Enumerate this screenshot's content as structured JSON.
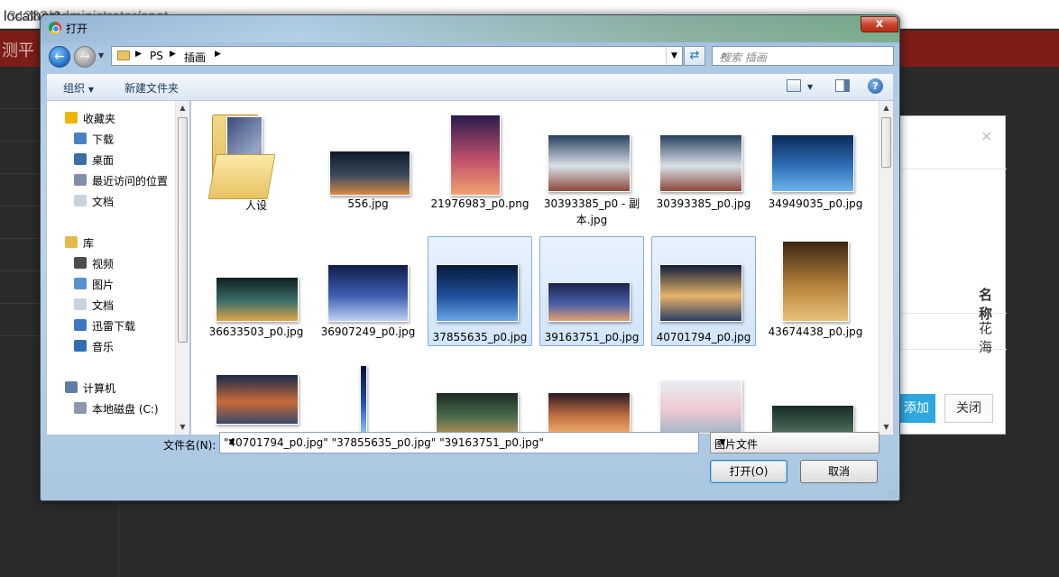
{
  "browser": {
    "url_visible": "localhost",
    "url_rest": ":34282/Administrator/spot",
    "header_title": "测平",
    "modal": {
      "close_glyph": "×",
      "column_header": "名称",
      "row_value": "花海",
      "add_button": "添加",
      "close_button": "关闭"
    }
  },
  "dialog": {
    "title": "打开",
    "close_glyph": "x",
    "breadcrumb": [
      "PS",
      "插画"
    ],
    "search_placeholder": "搜索 插画",
    "toolbar": {
      "organize": "组织",
      "new_folder": "新建文件夹"
    },
    "nav_items": [
      {
        "label": "收藏夹",
        "icon": "star-icon",
        "color": "#f0b400"
      },
      {
        "label": "下载",
        "icon": "download-folder-icon",
        "color": "#4a7fc1"
      },
      {
        "label": "桌面",
        "icon": "desktop-icon",
        "color": "#3a6ea5"
      },
      {
        "label": "最近访问的位置",
        "icon": "recent-places-icon",
        "color": "#7f8fa6"
      },
      {
        "label": "文档",
        "icon": "documents-icon",
        "color": "#c9d3df"
      },
      {
        "label": "库",
        "icon": "libraries-icon",
        "color": "#e5b94a"
      },
      {
        "label": "视频",
        "icon": "videos-icon",
        "color": "#4d4d4d"
      },
      {
        "label": "图片",
        "icon": "pictures-icon",
        "color": "#5a8fd0"
      },
      {
        "label": "文档",
        "icon": "documents-icon",
        "color": "#c9d3df"
      },
      {
        "label": "迅雷下载",
        "icon": "thunder-folder-icon",
        "color": "#3d77c4"
      },
      {
        "label": "音乐",
        "icon": "music-icon",
        "color": "#2f6db5"
      },
      {
        "label": "计算机",
        "icon": "computer-icon",
        "color": "#5c7ea8"
      },
      {
        "label": "本地磁盘 (C:)",
        "icon": "disk-icon",
        "color": "#8a99ab"
      }
    ],
    "files": [
      {
        "name": "人设",
        "type": "folder",
        "selected": false
      },
      {
        "name": "556.jpg",
        "type": "image",
        "selected": false,
        "colors": [
          "#0d1a2b",
          "#3a4a5c",
          "#d78a44"
        ]
      },
      {
        "name": "21976983_p0.png",
        "type": "image",
        "selected": false,
        "colors": [
          "#2a1b4d",
          "#c0506a",
          "#f0a070"
        ]
      },
      {
        "name": "30393385_p0 - 副本.jpg",
        "type": "image",
        "selected": false,
        "colors": [
          "#26405e",
          "#d9dfe6",
          "#8c4a3a"
        ]
      },
      {
        "name": "30393385_p0.jpg",
        "type": "image",
        "selected": false,
        "colors": [
          "#26405e",
          "#d9dfe6",
          "#8c4a3a"
        ]
      },
      {
        "name": "34949035_p0.jpg",
        "type": "image",
        "selected": false,
        "colors": [
          "#0a2a5a",
          "#2f6fb8",
          "#6bb3ea"
        ]
      },
      {
        "name": "36633503_p0.jpg",
        "type": "image",
        "selected": false,
        "colors": [
          "#0f1e22",
          "#3c6f6a",
          "#e0a64a"
        ]
      },
      {
        "name": "36907249_p0.jpg",
        "type": "image",
        "selected": false,
        "colors": [
          "#0e1d4a",
          "#3d5fb0",
          "#bcd2f0"
        ]
      },
      {
        "name": "37855635_p0.jpg",
        "type": "image",
        "selected": true,
        "colors": [
          "#061a3a",
          "#1f4f9a",
          "#6aa6e6"
        ]
      },
      {
        "name": "39163751_p0.jpg",
        "type": "image",
        "selected": true,
        "colors": [
          "#1b2450",
          "#4a5ea6",
          "#e0a070"
        ]
      },
      {
        "name": "40701794_p0.jpg",
        "type": "image",
        "selected": true,
        "colors": [
          "#101c38",
          "#e6b36a",
          "#2c3e66"
        ]
      },
      {
        "name": "43674438_p0.jpg",
        "type": "image",
        "selected": false,
        "colors": [
          "#3a2612",
          "#b5813a",
          "#e8c27a"
        ]
      },
      {
        "name": "",
        "type": "image",
        "selected": false,
        "colors": [
          "#1a2a4a",
          "#c86a3a",
          "#3a4a6a"
        ]
      },
      {
        "name": "",
        "type": "image",
        "selected": false,
        "colors": [
          "#061030",
          "#2050b0",
          "#8ac0ff"
        ]
      },
      {
        "name": "",
        "type": "image",
        "selected": false,
        "colors": [
          "#1a2a22",
          "#4a6a4a",
          "#b0905a"
        ]
      },
      {
        "name": "",
        "type": "image",
        "selected": false,
        "colors": [
          "#2a1a22",
          "#c07040",
          "#f0b070"
        ]
      },
      {
        "name": "",
        "type": "image",
        "selected": false,
        "colors": [
          "#e8eef4",
          "#f0c8d0",
          "#a8b8c8"
        ]
      },
      {
        "name": "",
        "type": "image",
        "selected": false,
        "colors": [
          "#1a2a2a",
          "#3a5a4a",
          "#6a7a6a"
        ]
      }
    ],
    "filename_label": "文件名(N):",
    "filename_value": "\"40701794_p0.jpg\" \"37855635_p0.jpg\" \"39163751_p0.jpg\"",
    "filetype_value": "图片文件",
    "open_button": "打开(O)",
    "cancel_button": "取消"
  }
}
